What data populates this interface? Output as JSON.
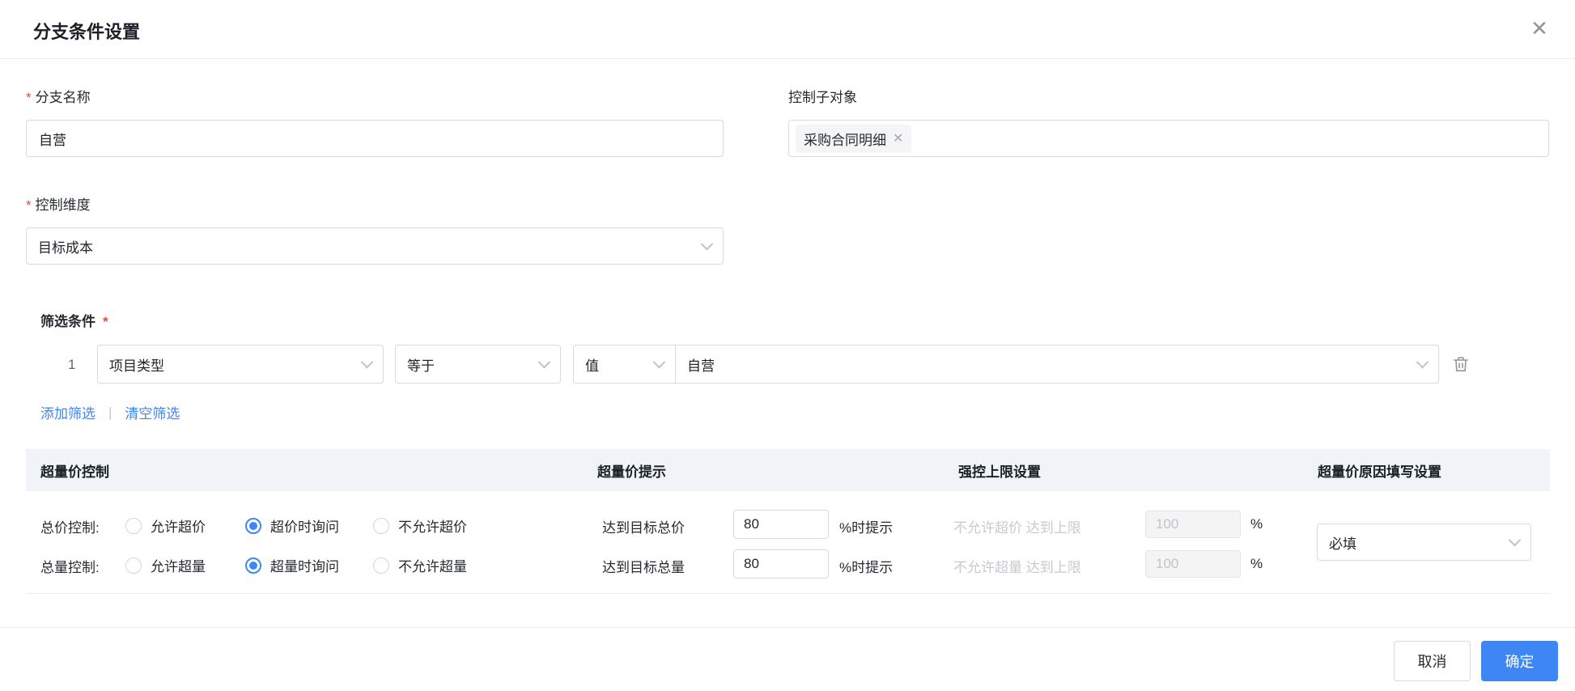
{
  "dialog": {
    "title": "分支条件设置",
    "close_icon": "✕"
  },
  "form": {
    "branch_name": {
      "required": "*",
      "label": "分支名称",
      "value": "自营"
    },
    "control_sub_object": {
      "label": "控制子对象",
      "tag": "采购合同明细",
      "tag_remove": "✕"
    },
    "control_dimension": {
      "required": "*",
      "label": "控制维度",
      "value": "目标成本"
    },
    "filter": {
      "label": "筛选条件",
      "required": "*",
      "rows": [
        {
          "index": "1",
          "field": "项目类型",
          "operator": "等于",
          "value_type": "值",
          "value": "自营"
        }
      ],
      "add_link": "添加筛选",
      "separator": "|",
      "clear_link": "清空筛选"
    }
  },
  "control_table": {
    "headers": [
      "超量价控制",
      "超量价提示",
      "强控上限设置",
      "超量价原因填写设置"
    ],
    "rows": [
      {
        "label": "总价控制:",
        "options": [
          "允许超价",
          "超价时询问",
          "不允许超价"
        ],
        "selected": "超价时询问",
        "tip_prefix": "达到目标总价",
        "tip_value": "80",
        "tip_suffix": "%时提示",
        "limit_text": "不允许超价 达到上限",
        "limit_value": "100",
        "limit_suffix": "%"
      },
      {
        "label": "总量控制:",
        "options": [
          "允许超量",
          "超量时询问",
          "不允许超量"
        ],
        "selected": "超量时询问",
        "tip_prefix": "达到目标总量",
        "tip_value": "80",
        "tip_suffix": "%时提示",
        "limit_text": "不允许超量 达到上限",
        "limit_value": "100",
        "limit_suffix": "%"
      }
    ],
    "reason_setting": {
      "value": "必填"
    }
  },
  "footer": {
    "cancel": "取消",
    "confirm": "确定"
  },
  "colors": {
    "primary": "#3d86f4",
    "link": "#3d86f4",
    "required": "#f0483e",
    "header_bg": "#f0f3f8",
    "border": "#d6d9dd",
    "disabled_text": "#c6cad1"
  }
}
